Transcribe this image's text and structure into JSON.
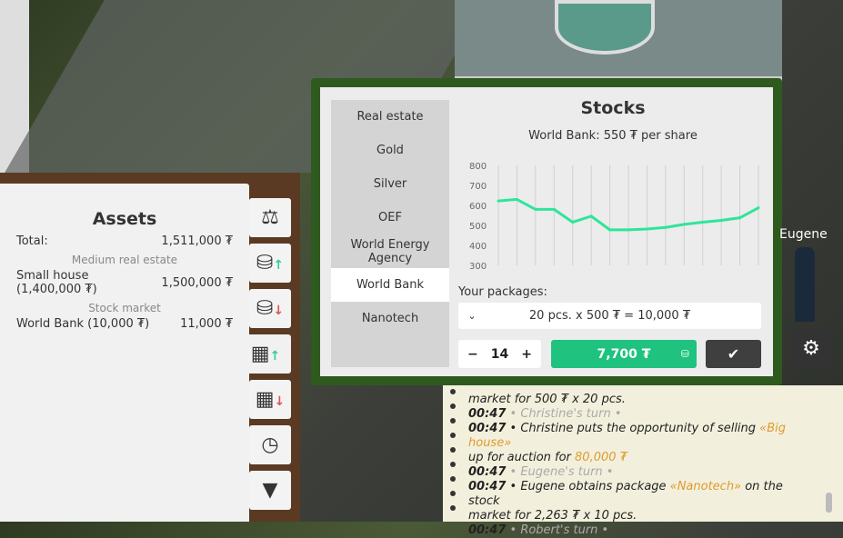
{
  "assets": {
    "title": "Assets",
    "total_label": "Total:",
    "total_value": "1,511,000 ₮",
    "sections": [
      {
        "heading": "Medium real estate",
        "items": [
          {
            "name": "Small house\n(1,400,000 ₮)",
            "value": "1,500,000 ₮"
          }
        ]
      },
      {
        "heading": "Stock market",
        "items": [
          {
            "name": "World Bank (10,000 ₮)",
            "value": "11,000 ₮"
          }
        ]
      }
    ]
  },
  "side_tabs": [
    {
      "icon": "scales-icon"
    },
    {
      "icon": "coins-up-icon"
    },
    {
      "icon": "coins-down-icon"
    },
    {
      "icon": "building-up-icon",
      "active": true
    },
    {
      "icon": "building-down-icon"
    },
    {
      "icon": "clock-icon"
    },
    {
      "icon": "tie-icon"
    }
  ],
  "dialog": {
    "categories": [
      "Real estate",
      "Gold",
      "Silver",
      "OEF",
      "World Energy Agency",
      "World Bank",
      "Nanotech"
    ],
    "active_category": "World Bank",
    "title": "Stocks",
    "subtitle": "World Bank: 550 ₮ per share",
    "packages_label": "Your packages:",
    "package_selected": "20 pcs. x 500 ₮ = 10,000 ₮",
    "quantity": "14",
    "minus": "−",
    "plus": "+",
    "buy_label": "7,700 ₮",
    "confirm_icon": "checkmark-icon"
  },
  "chart_data": {
    "type": "line",
    "yticks": [
      "800",
      "700",
      "600",
      "500",
      "400",
      "300"
    ],
    "ylim": [
      300,
      800
    ],
    "grid": "vertical",
    "values": [
      622,
      630,
      580,
      580,
      516,
      546,
      478,
      478,
      482,
      490,
      505,
      516,
      525,
      538,
      588
    ],
    "color": "#2ee59a"
  },
  "log": {
    "lines": [
      [
        {
          "t": "market for 500 ₮ x 20 pcs.",
          "c": ""
        }
      ],
      [
        {
          "t": "00:47",
          "c": "t"
        },
        {
          "t": " • Christine's turn •",
          "c": "g"
        }
      ],
      [
        {
          "t": "00:47",
          "c": "t"
        },
        {
          "t": " • Christine puts the opportunity of selling ",
          "c": ""
        },
        {
          "t": "«Big house»",
          "c": "o"
        }
      ],
      [
        {
          "t": "up for auction for ",
          "c": ""
        },
        {
          "t": "80,000 ₮",
          "c": "o"
        }
      ],
      [
        {
          "t": "00:47",
          "c": "t"
        },
        {
          "t": " • Eugene's turn •",
          "c": "g"
        }
      ],
      [
        {
          "t": "00:47",
          "c": "t"
        },
        {
          "t": " • Eugene obtains package ",
          "c": ""
        },
        {
          "t": "«Nanotech»",
          "c": "o"
        },
        {
          "t": " on the stock",
          "c": ""
        }
      ],
      [
        {
          "t": "market for 2,263 ₮ x 10 pcs.",
          "c": ""
        }
      ],
      [
        {
          "t": "00:47",
          "c": "t"
        },
        {
          "t": " • Robert's turn •",
          "c": "g"
        }
      ]
    ]
  },
  "player": {
    "name": "Eugene"
  }
}
